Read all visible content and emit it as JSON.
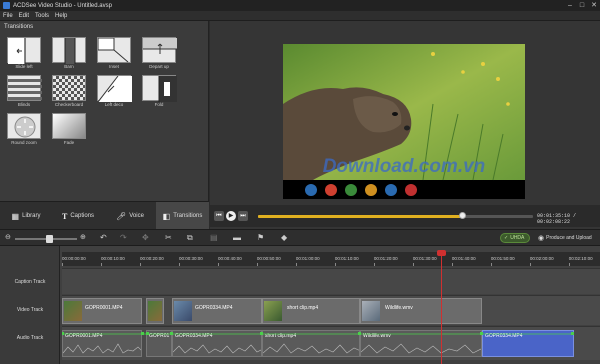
{
  "window": {
    "title": "ACDSee Video Studio - Untitled.avsp"
  },
  "menu": [
    {
      "label": "File"
    },
    {
      "label": "Edit"
    },
    {
      "label": "Tools"
    },
    {
      "label": "Help"
    }
  ],
  "transitions": {
    "header": "Transitions",
    "items": [
      {
        "label": "Slide left"
      },
      {
        "label": "Barn"
      },
      {
        "label": "Inset"
      },
      {
        "label": "Depart up"
      },
      {
        "label": "Blinds"
      },
      {
        "label": "Checkerboard"
      },
      {
        "label": "Left deco"
      },
      {
        "label": "Fold"
      },
      {
        "label": "Round zoom"
      },
      {
        "label": "Fade"
      }
    ]
  },
  "tabs": [
    {
      "label": "Library"
    },
    {
      "label": "Captions"
    },
    {
      "label": "Voice"
    },
    {
      "label": "Transitions"
    }
  ],
  "playback": {
    "progress": 0.74,
    "timecode": "00:01:35:10 / 00:02:08:22"
  },
  "watermark": "Download.com.vn",
  "toolbar": {
    "uhd_label": "UHDA",
    "produce_label": "Produce and Upload",
    "zoom": 0.55
  },
  "tracks": [
    {
      "label": "Caption Track"
    },
    {
      "label": "Video Track"
    },
    {
      "label": "Audio Track"
    }
  ],
  "ruler": [
    "00:00:00:00",
    "00:00:10:00",
    "00:00:20:00",
    "00:00:30:00",
    "00:00:40:00",
    "00:00:50:00",
    "00:01:00:00",
    "00:01:10:00",
    "00:01:20:00",
    "00:01:30:00",
    "00:01:40:00",
    "00:01:50:00",
    "00:02:00:00",
    "00:02:10:00"
  ],
  "video_clips": [
    {
      "label": "GOPR0001.MP4"
    },
    {
      "label": "GOPR0334.MP4"
    },
    {
      "label": "short clip.mp4"
    },
    {
      "label": "Wildlife.wmv"
    }
  ],
  "audio_clips": [
    {
      "label": "GOPR0001.MP4"
    },
    {
      "label": "GOPR01"
    },
    {
      "label": "GOPR0334.MP4"
    },
    {
      "label": "short clip.mp4"
    },
    {
      "label": "Wildlife.wmv"
    },
    {
      "label": "GOPR0334.MP4"
    }
  ],
  "colors": {
    "accent": "#e0b020",
    "playhead": "#d03030",
    "selected_audio": "#4a64c8"
  }
}
